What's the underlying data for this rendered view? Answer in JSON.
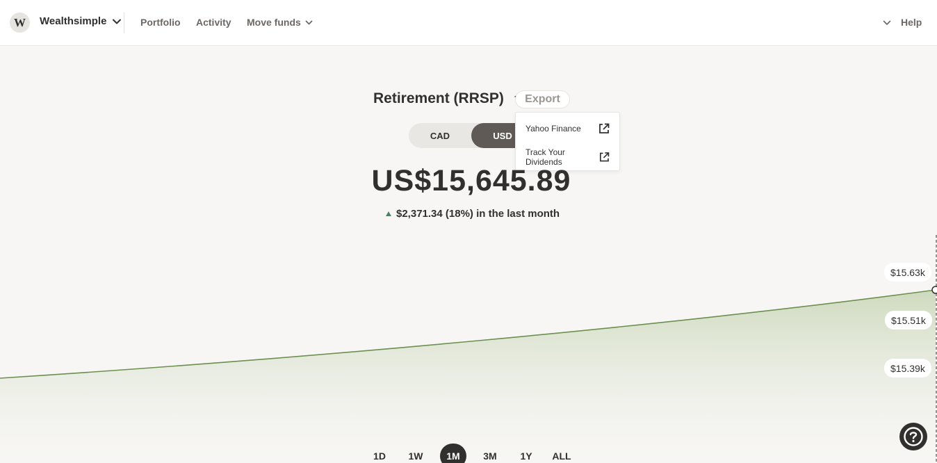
{
  "nav": {
    "logo_letter": "W",
    "brand": "Wealthsimple",
    "links": [
      "Portfolio",
      "Activity",
      "Move funds"
    ],
    "help": "Help"
  },
  "account": {
    "title": "Retirement (RRSP)",
    "export_label": "Export",
    "export_menu": [
      "Yahoo Finance",
      "Track Your Dividends"
    ],
    "currency_options": [
      "CAD",
      "USD"
    ],
    "selected_currency": "USD",
    "balance": "US$15,645.89",
    "change_text": "$2,371.34 (18%) in the last month"
  },
  "chart_data": {
    "type": "area",
    "tick_labels": [
      "$15.63k",
      "$15.51k",
      "$15.39k"
    ],
    "color": "#6b8f4e"
  },
  "ranges": {
    "options": [
      "1D",
      "1W",
      "1M",
      "3M",
      "1Y",
      "ALL"
    ],
    "selected": "1M"
  },
  "colors": {
    "accent_dark": "#32302f",
    "toggle_active": "#5f5a56",
    "chart_line": "#6b8f4e",
    "up_indicator": "#4f7d65"
  }
}
